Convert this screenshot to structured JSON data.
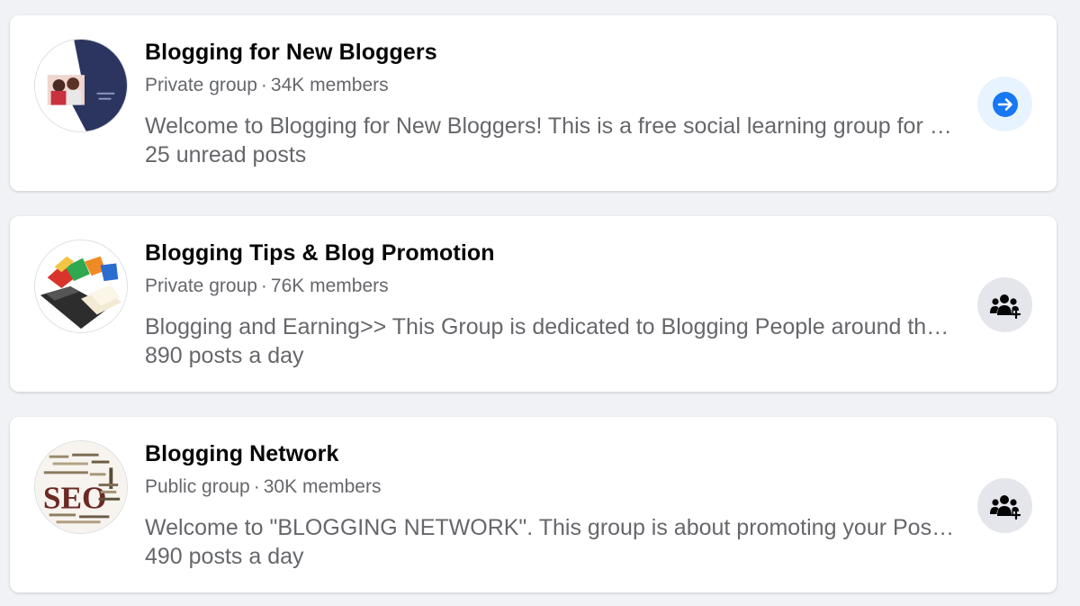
{
  "groups": [
    {
      "name": "Blogging for New Bloggers",
      "privacy": "Private group",
      "members": "34K members",
      "description": "Welcome to Blogging for New Bloggers! This is a free social learning group for new bloggers",
      "activity": "25 unread posts",
      "action_icon": "arrow-right-icon",
      "action_color": "#1877f2"
    },
    {
      "name": "Blogging Tips & Blog Promotion",
      "privacy": "Private group",
      "members": "76K members",
      "description": "Blogging and Earning>> This Group is dedicated to Blogging People around the world",
      "activity": "890 posts a day",
      "action_icon": "join-group-icon",
      "action_color": "#050505"
    },
    {
      "name": "Blogging Network",
      "privacy": "Public group",
      "members": "30K members",
      "description": "Welcome to \"BLOGGING NETWORK\". This group is about promoting your Posts and Blogs",
      "activity": "490 posts a day",
      "action_icon": "join-group-icon",
      "action_color": "#050505"
    }
  ],
  "separator": "·"
}
